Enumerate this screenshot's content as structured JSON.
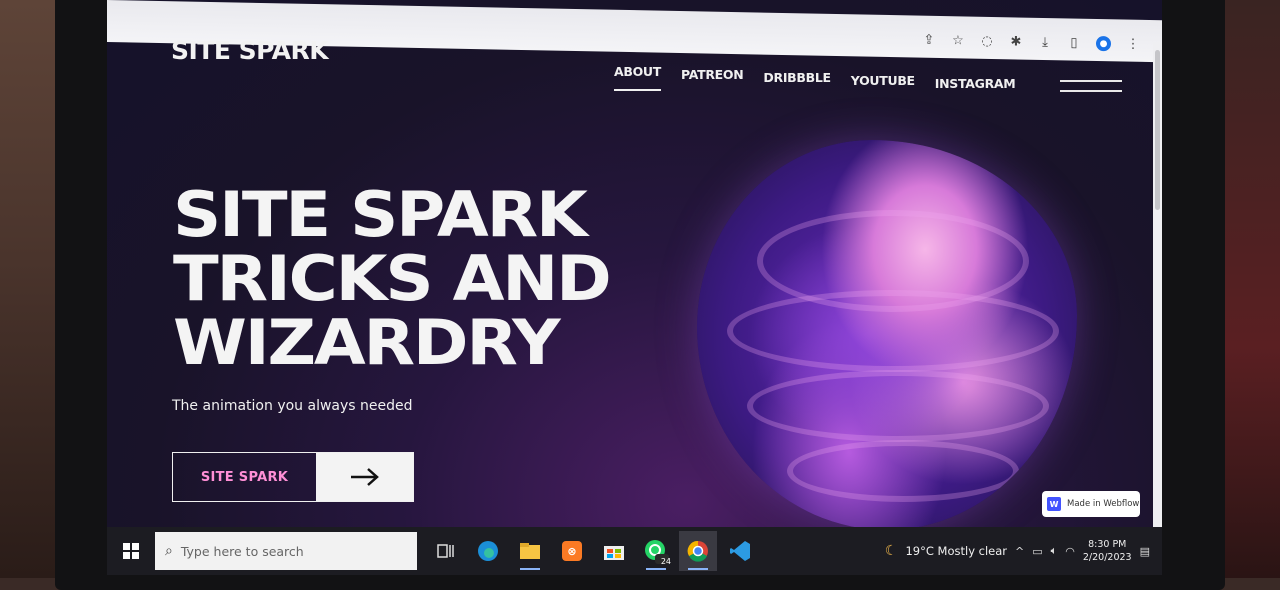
{
  "site": {
    "logo": "SITE SPARK",
    "nav": [
      "ABOUT",
      "PATREON",
      "DRIBBBLE",
      "YOUTUBE",
      "INSTAGRAM"
    ],
    "active_nav": "ABOUT"
  },
  "hero": {
    "title_lines": [
      "SITE SPARK",
      "TRICKS AND",
      "WIZARDRY"
    ],
    "subtitle": "The animation you always needed",
    "cta_label": "SITE SPARK",
    "cta_arrow": "→"
  },
  "badge": {
    "mark": "W",
    "text": "Made in Webflow"
  },
  "browser": {
    "icons": [
      "share-icon",
      "star-icon",
      "loading-icon",
      "extensions-icon",
      "download-icon",
      "sidebar-icon",
      "profile-icon",
      "more-icon"
    ]
  },
  "taskbar": {
    "search_placeholder": "Type here to search",
    "apps": [
      "task-view",
      "edge",
      "file-explorer",
      "xampp",
      "microsoft-store",
      "whatsapp",
      "chrome",
      "vscode"
    ],
    "whatsapp_badge": "24",
    "weather": "19°C  Mostly clear",
    "time": "8:30 PM",
    "date": "2/20/2023"
  },
  "colors": {
    "background": "#191329",
    "cta_text": "#ff8fd6",
    "blob_primary": "#8f45d8",
    "blob_highlight": "#f6b6e8"
  }
}
